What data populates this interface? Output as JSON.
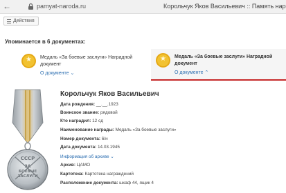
{
  "browser": {
    "url": "pamyat-naroda.ru",
    "tab_title": "Корольчук Яков Васильевич :: Память народа"
  },
  "toolbar": {
    "actions_label": "Действия"
  },
  "mentioned": {
    "title": "Упоминается в 6 документах:"
  },
  "documents": [
    {
      "text": "Медаль «За боевые заслуги» Наградной документ",
      "link": "О документе ⌄"
    },
    {
      "text": "Медаль «За боевые заслуги» Наградной документ",
      "link": "О документе ⌃"
    }
  ],
  "person": {
    "name": "Корольчук Яков Васильевич",
    "fields": [
      {
        "label": "Дата рождения:",
        "value": "__.__.1923"
      },
      {
        "label": "Воинское звание:",
        "value": "рядовой"
      },
      {
        "label": "Кто наградил:",
        "value": "12 сд"
      },
      {
        "label": "Наименование награды:",
        "value": "Медаль «За боевые заслуги»"
      },
      {
        "label": "Номер документа:",
        "value": "6/н"
      },
      {
        "label": "Дата документа:",
        "value": "14.03.1945"
      },
      {
        "label": "Информация об архиве",
        "value": "⌄"
      },
      {
        "label": "Архив:",
        "value": "ЦАМО"
      },
      {
        "label": "Картотека:",
        "value": "Картотека награждений"
      },
      {
        "label": "Расположение документа:",
        "value": "шкаф 44, ящик 4"
      }
    ]
  },
  "medal_image": {
    "inscriptions": [
      "СССР",
      "ЗА",
      "БОЕВЫЕ",
      "ЗАСЛУГИ"
    ]
  },
  "colors": {
    "accent_red": "#c62828",
    "link_blue": "#2a6db0",
    "medal_gold": "#f2c230"
  }
}
